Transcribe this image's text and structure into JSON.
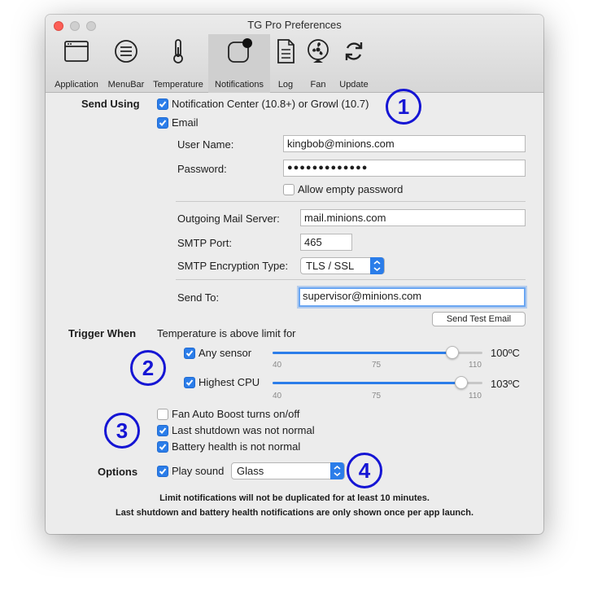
{
  "window": {
    "title": "TG Pro Preferences"
  },
  "toolbar": {
    "items": [
      {
        "label": "Application"
      },
      {
        "label": "MenuBar"
      },
      {
        "label": "Temperature"
      },
      {
        "label": "Notifications",
        "selected": true
      },
      {
        "label": "Log"
      },
      {
        "label": "Fan"
      },
      {
        "label": "Update"
      }
    ]
  },
  "send_using": {
    "label": "Send Using",
    "notification_center": {
      "label": "Notification Center (10.8+) or Growl (10.7)",
      "checked": true
    },
    "email": {
      "label": "Email",
      "checked": true
    },
    "username": {
      "label": "User Name:",
      "value": "kingbob@minions.com"
    },
    "password": {
      "label": "Password:",
      "value": "●●●●●●●●●●●●●"
    },
    "allow_empty_password": {
      "label": "Allow empty password",
      "checked": false
    },
    "outgoing_server": {
      "label": "Outgoing Mail Server:",
      "value": "mail.minions.com"
    },
    "smtp_port": {
      "label": "SMTP Port:",
      "value": "465"
    },
    "smtp_encryption": {
      "label": "SMTP Encryption Type:",
      "value": "TLS / SSL"
    },
    "send_to": {
      "label": "Send To:",
      "value": "supervisor@minions.com"
    },
    "send_test_button": "Send Test Email"
  },
  "trigger_when": {
    "label": "Trigger When",
    "description": "Temperature is above limit for",
    "any_sensor": {
      "label": "Any sensor",
      "checked": true,
      "value_label": "100ºC",
      "value": 100,
      "min": 40,
      "max": 110,
      "ticks": [
        "40",
        "75",
        "110"
      ]
    },
    "highest_cpu": {
      "label": "Highest CPU",
      "checked": true,
      "value_label": "103ºC",
      "value": 103,
      "min": 40,
      "max": 110,
      "ticks": [
        "40",
        "75",
        "110"
      ]
    },
    "fan_auto_boost": {
      "label": "Fan Auto Boost turns on/off",
      "checked": false
    },
    "last_shutdown": {
      "label": "Last shutdown was not normal",
      "checked": true
    },
    "battery_health": {
      "label": "Battery health is not normal",
      "checked": true
    }
  },
  "options": {
    "label": "Options",
    "play_sound": {
      "label": "Play sound",
      "checked": true
    },
    "sound": {
      "value": "Glass"
    }
  },
  "notes": {
    "line1": "Limit notifications will not be duplicated for at least 10 minutes.",
    "line2": "Last shutdown and battery health notifications are only shown once per app launch."
  },
  "callouts": [
    "1",
    "2",
    "3",
    "4"
  ],
  "colors": {
    "accent": "#2b7de9",
    "callout": "#1515d4",
    "close": "#fc5f57"
  }
}
